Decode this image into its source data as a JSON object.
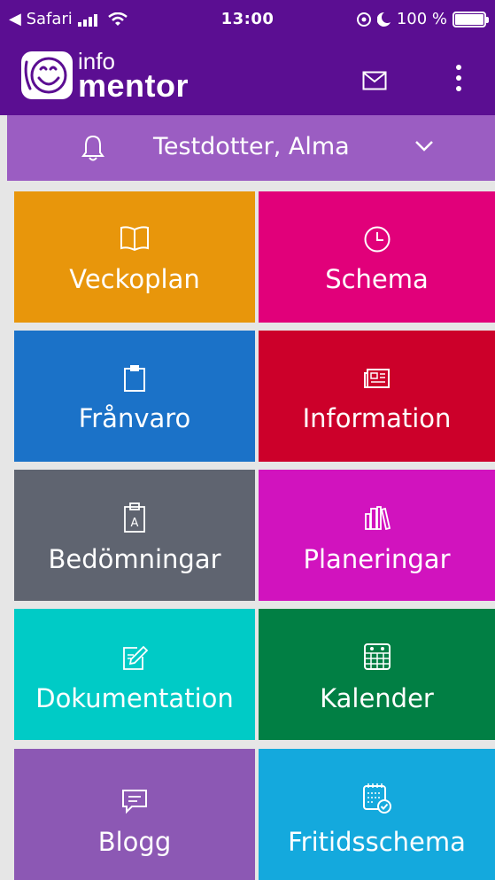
{
  "status_bar": {
    "back_app": "◀ Safari",
    "time": "13:00",
    "battery": "100 %"
  },
  "header": {
    "logo_top": "info",
    "logo_bottom": "mentor"
  },
  "student": {
    "name": "Testdotter, Alma"
  },
  "tiles": [
    {
      "label": "Veckoplan",
      "color": "#e8960b",
      "icon": "book-icon"
    },
    {
      "label": "Schema",
      "color": "#e1007a",
      "icon": "clock-icon"
    },
    {
      "label": "Frånvaro",
      "color": "#1b72c8",
      "icon": "clipboard-icon"
    },
    {
      "label": "Information",
      "color": "#cc002a",
      "icon": "newspaper-icon"
    },
    {
      "label": "Bedömningar",
      "color": "#5f6470",
      "icon": "clipboard-grade-icon"
    },
    {
      "label": "Planeringar",
      "color": "#d113be",
      "icon": "books-icon"
    },
    {
      "label": "Dokumentation",
      "color": "#00cbc6",
      "icon": "edit-document-icon"
    },
    {
      "label": "Kalender",
      "color": "#017f44",
      "icon": "calendar-icon"
    },
    {
      "label": "Blogg",
      "color": "#8c58b4",
      "icon": "chat-icon"
    },
    {
      "label": "Fritidsschema",
      "color": "#14a9dd",
      "icon": "calendar-check-icon"
    }
  ]
}
